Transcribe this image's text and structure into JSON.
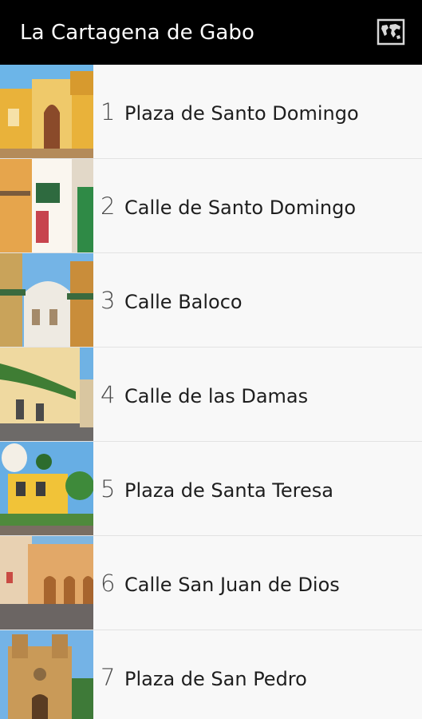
{
  "app": {
    "title": "La Cartagena de Gabo",
    "map_icon": "world-map-icon"
  },
  "items": [
    {
      "number": "1",
      "label": "Plaza de Santo Domingo"
    },
    {
      "number": "2",
      "label": "Calle de Santo Domingo"
    },
    {
      "number": "3",
      "label": "Calle Baloco"
    },
    {
      "number": "4",
      "label": "Calle de las Damas"
    },
    {
      "number": "5",
      "label": "Plaza de Santa Teresa"
    },
    {
      "number": "6",
      "label": "Calle San Juan de Dios"
    },
    {
      "number": "7",
      "label": "Plaza de San Pedro"
    }
  ]
}
